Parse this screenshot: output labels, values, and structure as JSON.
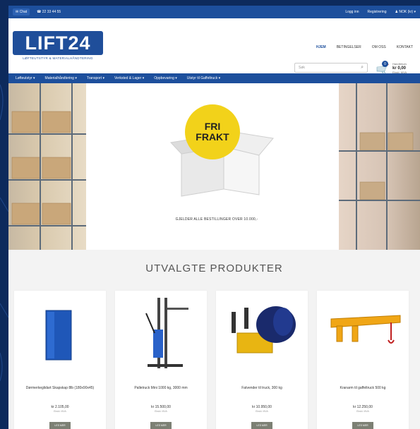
{
  "topbar": {
    "chat_label": "Chat",
    "phone": "22 33 44 55",
    "links": [
      "Logg inn",
      "Registrering"
    ],
    "currency": "NOK (kr)"
  },
  "logo": {
    "name": "LIFT24",
    "tagline": "LØFTEUTSTYR & MATERIALHÅNDTERING"
  },
  "nav": {
    "items": [
      "HJEM",
      "BETINGELSER",
      "OM OSS",
      "KONTAKT"
    ]
  },
  "search": {
    "placeholder": "Søk"
  },
  "cart": {
    "count": "0",
    "label": "Handlekurv",
    "total": "kr 0,00",
    "vat": "Ekskl. MVA"
  },
  "categories": [
    "Løfteutstyr ▾",
    "Materialhåndtering ▾",
    "Transport ▾",
    "Verksted & Lager ▾",
    "Oppbevaring ▾",
    "Utstyr til Gaffeltruck ▾"
  ],
  "banner": {
    "badge_line1": "FRI",
    "badge_line2": "FRAKT",
    "caption": "GJELDER ALLE BESTILLINGER OVER 10.000,-"
  },
  "featured": {
    "title": "UTVALGTE PRODUKTER",
    "products": [
      {
        "name": "Dørmerkeglidart Skapskap 8lb (180x90x45)",
        "price": "kr 2.105,00",
        "vat": "Ekskl. MVA",
        "button": "LES MER"
      },
      {
        "name": "Palletruck Mini 1000 kg, 3000 mm",
        "price": "kr 15.500,00",
        "vat": "Ekskl. MVA",
        "button": "LES MER"
      },
      {
        "name": "Fatvender til truck, 300 kg",
        "price": "kr 10.950,00",
        "vat": "Ekskl. MVA",
        "button": "LES MER",
        "sub": "Ekskl. MVA"
      },
      {
        "name": "Kranarm til gaffeltruck 500 kg",
        "price": "kr 12.250,00",
        "vat": "Ekskl. MVA",
        "button": "LES MER"
      }
    ]
  },
  "colors": {
    "brand_blue": "#1d4f9c",
    "badge_yellow": "#f2d21a",
    "button_gray": "#7c8074"
  }
}
